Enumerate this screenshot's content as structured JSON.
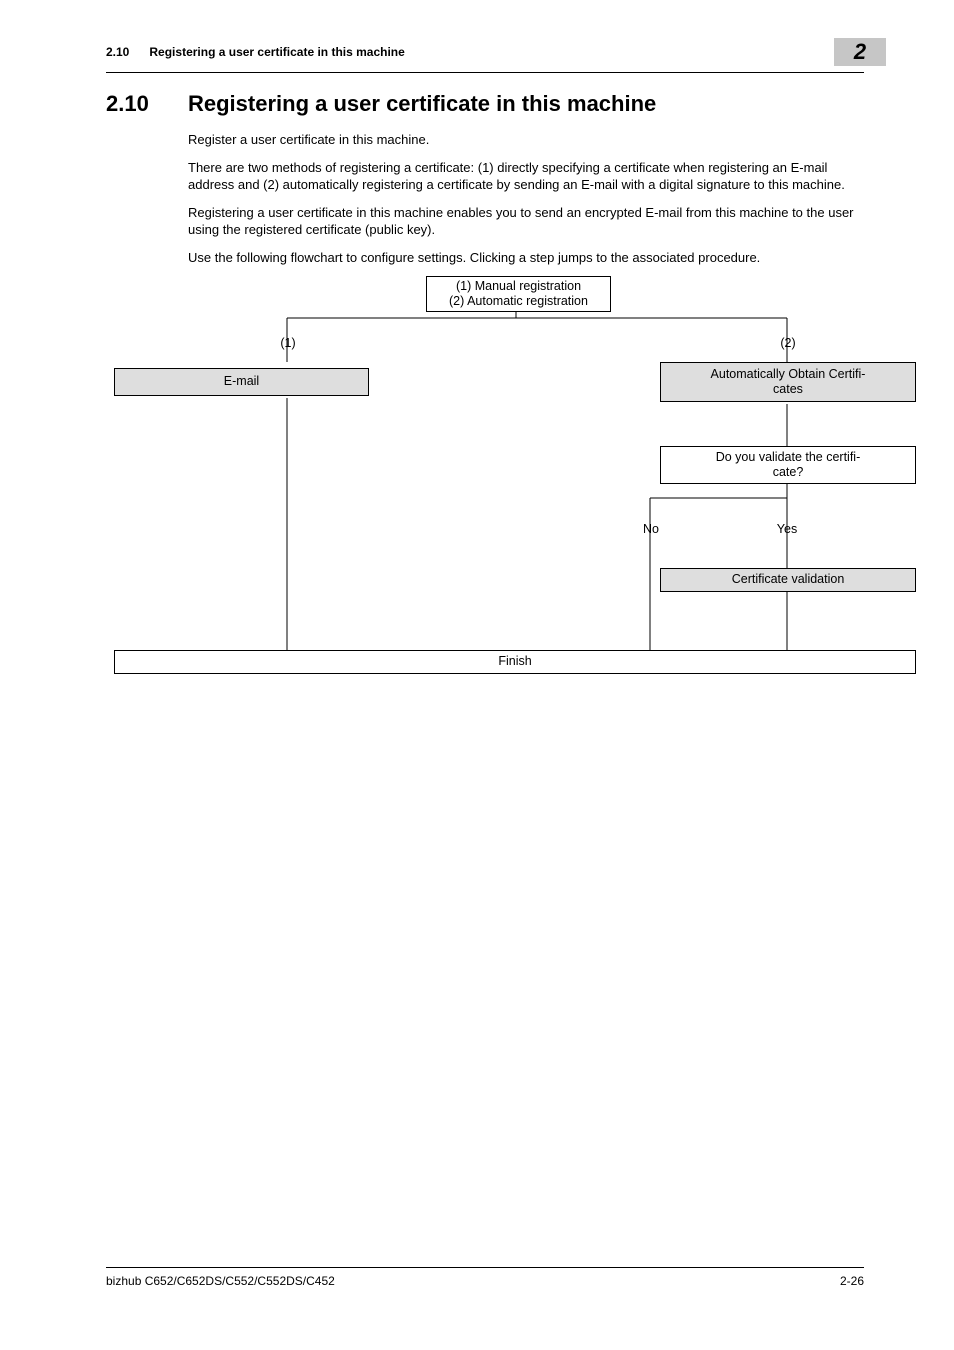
{
  "header": {
    "section_no_top": "2.10",
    "section_title_top": "Registering a user certificate in this machine",
    "chapter_no": "2"
  },
  "section": {
    "number": "2.10",
    "title": "Registering a user certificate in this machine"
  },
  "paragraphs": {
    "p1": "Register a user certificate in this machine.",
    "p2": "There are two methods of registering a certificate: (1) directly specifying a certificate when registering an E-mail address and (2) automatically registering a certificate by sending an E-mail with a digital signature to this machine.",
    "p3": "Registering a user certificate in this machine enables you to send an encrypted E-mail from this machine to the user using the registered certificate (public key).",
    "p4": "Use the following flowchart to configure settings. Clicking a step jumps to the associated procedure."
  },
  "flowchart": {
    "top_box_line1": "(1) Manual registration",
    "top_box_line2": "(2) Automatic registration",
    "label_1": "(1)",
    "label_2": "(2)",
    "email_box": "E-mail",
    "auto_obtain_line1": "Automatically Obtain Certifi-",
    "auto_obtain_line2": "cates",
    "validate_line1": "Do you validate the certifi-",
    "validate_line2": "cate?",
    "no": "No",
    "yes": "Yes",
    "cert_validation": "Certificate validation",
    "finish": "Finish"
  },
  "footer": {
    "model": "bizhub C652/C652DS/C552/C552DS/C452",
    "page_no": "2-26"
  },
  "chart_data": {
    "type": "flowchart",
    "nodes": [
      {
        "id": "start",
        "label": "(1) Manual registration\n(2) Automatic registration",
        "type": "start"
      },
      {
        "id": "email",
        "label": "E-mail",
        "type": "process",
        "branch": "(1)"
      },
      {
        "id": "auto",
        "label": "Automatically Obtain Certificates",
        "type": "process",
        "branch": "(2)"
      },
      {
        "id": "validate",
        "label": "Do you validate the certificate?",
        "type": "decision"
      },
      {
        "id": "certval",
        "label": "Certificate validation",
        "type": "process"
      },
      {
        "id": "finish",
        "label": "Finish",
        "type": "end"
      }
    ],
    "edges": [
      {
        "from": "start",
        "to": "email",
        "label": "(1)"
      },
      {
        "from": "start",
        "to": "auto",
        "label": "(2)"
      },
      {
        "from": "email",
        "to": "finish"
      },
      {
        "from": "auto",
        "to": "validate"
      },
      {
        "from": "validate",
        "to": "finish",
        "label": "No"
      },
      {
        "from": "validate",
        "to": "certval",
        "label": "Yes"
      },
      {
        "from": "certval",
        "to": "finish"
      }
    ]
  }
}
